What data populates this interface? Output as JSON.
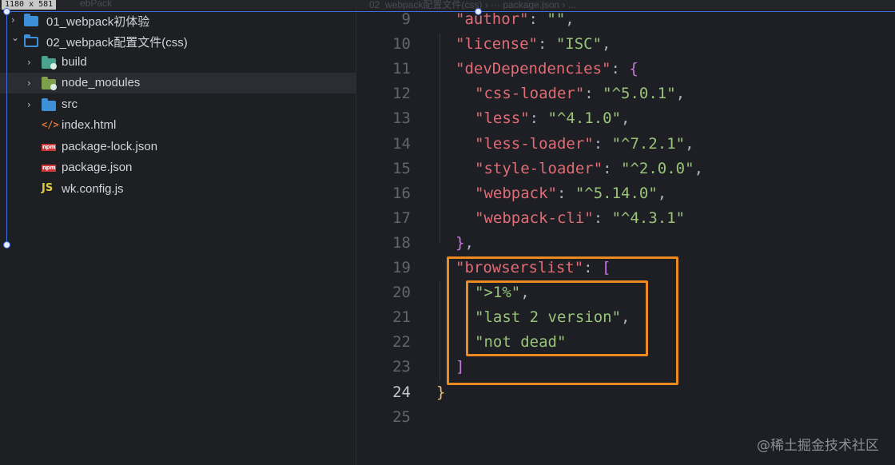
{
  "window": {
    "size_badge": "1180 x 581",
    "ghost_left": "ebPack",
    "ghost_right": "02_webpack配置文件(css) › ··· package.json › ..."
  },
  "explorer": {
    "items": [
      {
        "label": "01_webpack初体验",
        "icon": "folder-icon",
        "expanded": false
      },
      {
        "label": "02_webpack配置文件(css)",
        "icon": "folder-open-icon",
        "expanded": true
      },
      {
        "label": "build",
        "icon": "folder-build-icon",
        "expanded": false
      },
      {
        "label": "node_modules",
        "icon": "folder-node-modules-icon",
        "expanded": false,
        "selected": true
      },
      {
        "label": "src",
        "icon": "folder-icon",
        "expanded": false
      },
      {
        "label": "index.html",
        "icon": "html-file-icon",
        "glyph": "</>"
      },
      {
        "label": "package-lock.json",
        "icon": "npm-file-icon",
        "glyph": "npm"
      },
      {
        "label": "package.json",
        "icon": "npm-file-icon",
        "glyph": "npm"
      },
      {
        "label": "wk.config.js",
        "icon": "js-file-icon",
        "glyph": "JS"
      }
    ]
  },
  "editor": {
    "active_line": "24",
    "lines": [
      {
        "n": "9",
        "tokens": [
          [
            "key",
            "\"author\""
          ],
          [
            "pun",
            ": "
          ],
          [
            "str",
            "\"\""
          ],
          [
            "pun",
            ","
          ]
        ]
      },
      {
        "n": "10",
        "tokens": [
          [
            "key",
            "\"license\""
          ],
          [
            "pun",
            ": "
          ],
          [
            "str",
            "\"ISC\""
          ],
          [
            "pun",
            ","
          ]
        ]
      },
      {
        "n": "11",
        "tokens": [
          [
            "key",
            "\"devDependencies\""
          ],
          [
            "pun",
            ": "
          ],
          [
            "brk",
            "{"
          ]
        ]
      },
      {
        "n": "12",
        "tokens": [
          [
            "key",
            "\"css-loader\""
          ],
          [
            "pun",
            ": "
          ],
          [
            "str",
            "\"^5.0.1\""
          ],
          [
            "pun",
            ","
          ]
        ]
      },
      {
        "n": "13",
        "tokens": [
          [
            "key",
            "\"less\""
          ],
          [
            "pun",
            ": "
          ],
          [
            "str",
            "\"^4.1.0\""
          ],
          [
            "pun",
            ","
          ]
        ]
      },
      {
        "n": "14",
        "tokens": [
          [
            "key",
            "\"less-loader\""
          ],
          [
            "pun",
            ": "
          ],
          [
            "str",
            "\"^7.2.1\""
          ],
          [
            "pun",
            ","
          ]
        ]
      },
      {
        "n": "15",
        "tokens": [
          [
            "key",
            "\"style-loader\""
          ],
          [
            "pun",
            ": "
          ],
          [
            "str",
            "\"^2.0.0\""
          ],
          [
            "pun",
            ","
          ]
        ]
      },
      {
        "n": "16",
        "tokens": [
          [
            "key",
            "\"webpack\""
          ],
          [
            "pun",
            ": "
          ],
          [
            "str",
            "\"^5.14.0\""
          ],
          [
            "pun",
            ","
          ]
        ]
      },
      {
        "n": "17",
        "tokens": [
          [
            "key",
            "\"webpack-cli\""
          ],
          [
            "pun",
            ": "
          ],
          [
            "str",
            "\"^4.3.1\""
          ]
        ]
      },
      {
        "n": "18",
        "tokens": [
          [
            "brk",
            "}"
          ],
          [
            "pun",
            ","
          ]
        ]
      },
      {
        "n": "19",
        "tokens": [
          [
            "key",
            "\"browserslist\""
          ],
          [
            "pun",
            ": "
          ],
          [
            "brk",
            "["
          ]
        ]
      },
      {
        "n": "20",
        "tokens": [
          [
            "str",
            "\">1%\""
          ],
          [
            "pun",
            ","
          ]
        ]
      },
      {
        "n": "21",
        "tokens": [
          [
            "str",
            "\"last 2 version\""
          ],
          [
            "pun",
            ","
          ]
        ]
      },
      {
        "n": "22",
        "tokens": [
          [
            "str",
            "\"not dead\""
          ]
        ]
      },
      {
        "n": "23",
        "tokens": [
          [
            "brk",
            "]"
          ]
        ]
      },
      {
        "n": "24",
        "tokens": [
          [
            "brk2",
            "}"
          ]
        ]
      },
      {
        "n": "25",
        "tokens": []
      }
    ]
  },
  "watermark": "@稀土掘金技术社区",
  "colors": {
    "highlight_box": "#ec8a22",
    "json_key": "#e06c75",
    "json_string": "#98c379",
    "bracket": "#c678dd"
  }
}
